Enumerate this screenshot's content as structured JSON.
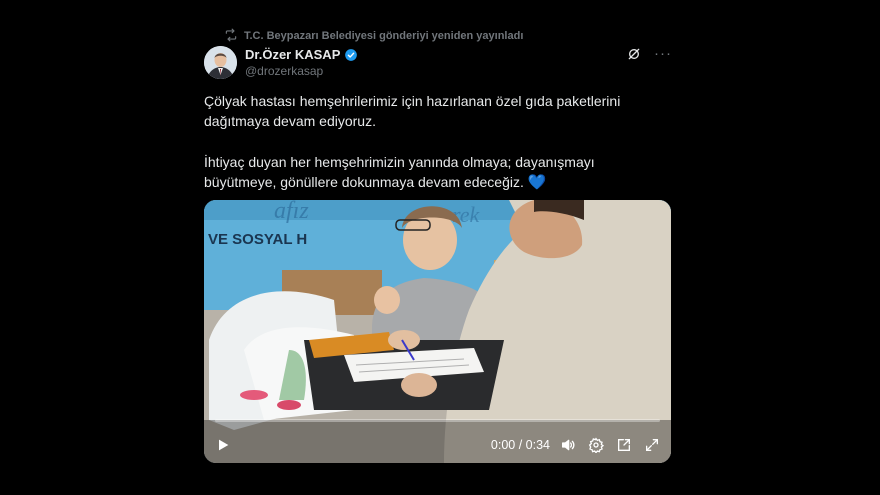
{
  "repost": {
    "text": "T.C. Beypazarı Belediyesi gönderiyi yeniden yayınladı",
    "icon": "repost-icon"
  },
  "author": {
    "name": "Dr.Özer KASAP",
    "handle": "@drozerkasap",
    "verified": true,
    "verified_color": "#1d9bf0"
  },
  "tweet": {
    "paragraph1": "Çölyak hastası hemşehrilerimiz için hazırlanan özel gıda paketlerini dağıtmaya devam ediyoruz.",
    "paragraph2": "İhtiyaç duyan her hemşehrimizin yanında olmaya; dayanışmayı büyütmeye, gönüllere dokunmaya devam edeceğiz.",
    "emoji": "💙"
  },
  "media": {
    "sign_text": "VE SOSYAL H",
    "progress": 0,
    "time_display": "0:00 / 0:34",
    "controls": [
      "play-icon",
      "volume-icon",
      "settings-icon",
      "popout-icon",
      "fullscreen-icon"
    ]
  },
  "colors": {
    "background": "#000000",
    "text": "#e7e9ea",
    "secondary": "#71767b",
    "accent": "#1d9bf0"
  }
}
